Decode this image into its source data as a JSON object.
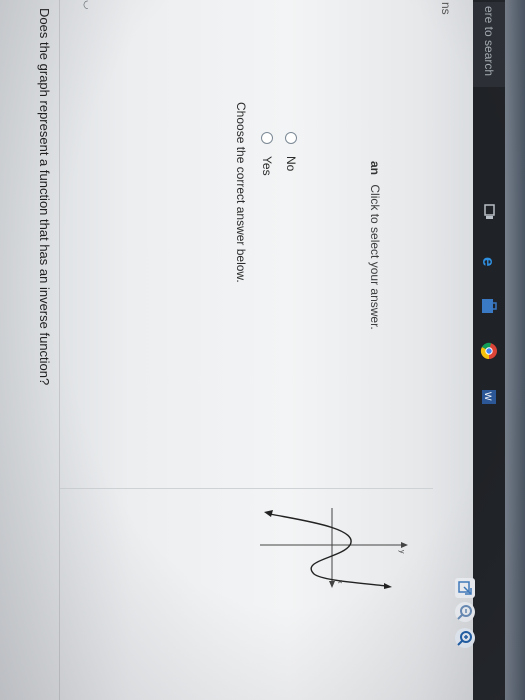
{
  "question": {
    "text": "Does the graph represent a function that has an inverse function?"
  },
  "instructions": {
    "choose_label": "Choose the correct answer below."
  },
  "options": [
    {
      "label": "Yes",
      "selected": false
    },
    {
      "label": "No",
      "selected": false
    }
  ],
  "hint": {
    "prefix": "an",
    "text": "Click to select your answer."
  },
  "sidebar": {
    "ns_label": "ns"
  },
  "taskbar": {
    "search_placeholder": "ere to search"
  },
  "colors": {
    "accent": "#2b73c9",
    "zoom_icon": "#1f5fa8",
    "taskbar": "#1f2226"
  },
  "icons": [
    "zoom-in-icon",
    "zoom-out-icon",
    "popout-icon",
    "task-view-icon",
    "edge-icon",
    "store-icon",
    "chrome-icon",
    "word-icon"
  ]
}
